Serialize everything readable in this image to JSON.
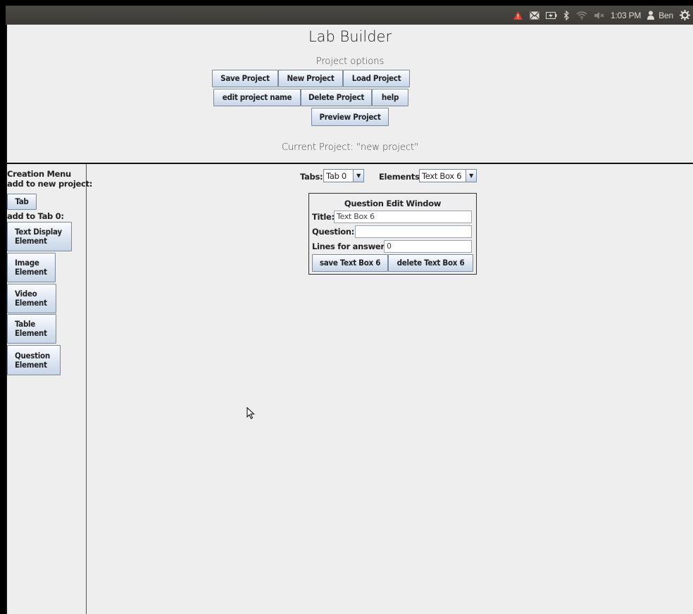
{
  "system_bar": {
    "time": "1:03 PM",
    "user": "Ben",
    "icons": [
      "warning-icon",
      "mail-icon",
      "battery-icon",
      "bluetooth-icon",
      "wifi-icon",
      "volume-muted-icon",
      "user-icon",
      "power-gear-icon"
    ],
    "accent_warning": "#e0402e"
  },
  "header": {
    "title": "Lab Builder",
    "options_label": "Project options",
    "buttons": {
      "save": "Save Project",
      "new": "New Project",
      "load": "Load Project",
      "edit_name": "edit project name",
      "delete": "Delete Project",
      "help": "help",
      "preview": "Preview Project"
    },
    "current_project": "Current Project: \"new project\""
  },
  "sidebar": {
    "title": "Creation Menu",
    "add_new_label": "add to new project:",
    "tab_button": "Tab",
    "add_tab_label": "add to Tab 0:",
    "elements": [
      {
        "line1": "Text Display",
        "line2": "Element"
      },
      {
        "line1": "Image",
        "line2": "Element"
      },
      {
        "line1": "Video",
        "line2": "Element"
      },
      {
        "line1": "Table",
        "line2": "Element"
      },
      {
        "line1": "Question",
        "line2": "Element"
      }
    ]
  },
  "main": {
    "tabs_label": "Tabs:",
    "tabs_value": "Tab 0",
    "elements_label": "Elements:",
    "elements_value": "Text Box 6",
    "question_window": {
      "title": "Question Edit Window",
      "title_label": "Title:",
      "title_value": "Text Box 6",
      "question_label": "Question:",
      "question_value": "",
      "lines_label": "Lines for answer:",
      "lines_value": "0",
      "save_button": "save Text Box 6",
      "delete_button": "delete Text Box 6"
    }
  }
}
